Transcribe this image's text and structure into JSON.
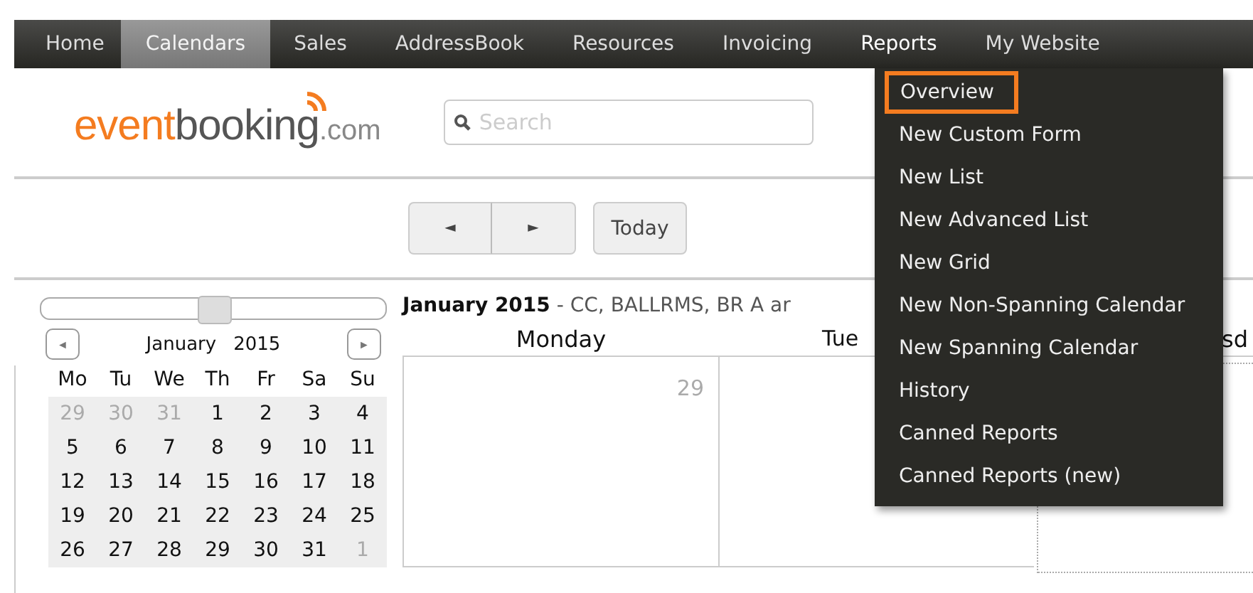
{
  "nav": [
    {
      "label": "Home",
      "selected": false,
      "expanded": false
    },
    {
      "label": "Calendars",
      "selected": true,
      "expanded": false
    },
    {
      "label": "Sales",
      "selected": false,
      "expanded": false
    },
    {
      "label": "AddressBook",
      "selected": false,
      "expanded": false
    },
    {
      "label": "Resources",
      "selected": false,
      "expanded": false
    },
    {
      "label": "Invoicing",
      "selected": false,
      "expanded": false
    },
    {
      "label": "Reports",
      "selected": false,
      "expanded": true
    },
    {
      "label": "My Website",
      "selected": false,
      "expanded": false
    }
  ],
  "logo": {
    "part_1": "event",
    "part_2": "booking",
    "part_3": ".com"
  },
  "search": {
    "placeholder": "Search"
  },
  "toolbar": {
    "prev": "◄",
    "next": "►",
    "today": "Today"
  },
  "sidebar": {
    "slider": {
      "level": 0.5
    },
    "month": "January",
    "year": "2015",
    "prev": "◄",
    "next": "►",
    "weekdays": [
      "Mo",
      "Tu",
      "We",
      "Th",
      "Fr",
      "Sa",
      "Su"
    ],
    "weeks": [
      [
        {
          "day": "29",
          "muted": true
        },
        {
          "day": "30",
          "muted": true
        },
        {
          "day": "31",
          "muted": true
        },
        {
          "day": "1",
          "muted": false
        },
        {
          "day": "2",
          "muted": false
        },
        {
          "day": "3",
          "muted": false
        },
        {
          "day": "4",
          "muted": false
        }
      ],
      [
        {
          "day": "5",
          "muted": false
        },
        {
          "day": "6",
          "muted": false
        },
        {
          "day": "7",
          "muted": false
        },
        {
          "day": "8",
          "muted": false
        },
        {
          "day": "9",
          "muted": false
        },
        {
          "day": "10",
          "muted": false
        },
        {
          "day": "11",
          "muted": false
        }
      ],
      [
        {
          "day": "12",
          "muted": false
        },
        {
          "day": "13",
          "muted": false
        },
        {
          "day": "14",
          "muted": false
        },
        {
          "day": "15",
          "muted": false
        },
        {
          "day": "16",
          "muted": false
        },
        {
          "day": "17",
          "muted": false
        },
        {
          "day": "18",
          "muted": false
        }
      ],
      [
        {
          "day": "19",
          "muted": false
        },
        {
          "day": "20",
          "muted": false
        },
        {
          "day": "21",
          "muted": false
        },
        {
          "day": "22",
          "muted": false
        },
        {
          "day": "23",
          "muted": false
        },
        {
          "day": "24",
          "muted": false
        },
        {
          "day": "25",
          "muted": false
        }
      ],
      [
        {
          "day": "26",
          "muted": false
        },
        {
          "day": "27",
          "muted": false
        },
        {
          "day": "28",
          "muted": false
        },
        {
          "day": "29",
          "muted": false
        },
        {
          "day": "30",
          "muted": false
        },
        {
          "day": "31",
          "muted": false
        },
        {
          "day": "1",
          "muted": true
        }
      ]
    ]
  },
  "calendar": {
    "title": "January 2015",
    "subtitle": "- CC, BALLRMS, BR A ar",
    "columns": [
      "Monday",
      "Tue",
      "sd"
    ],
    "first_cell_day": "29"
  },
  "menu": {
    "items": [
      {
        "label": "Overview",
        "selected": true
      },
      {
        "label": "New Custom Form",
        "selected": false
      },
      {
        "label": "New List",
        "selected": false
      },
      {
        "label": "New Advanced List",
        "selected": false
      },
      {
        "label": "New Grid",
        "selected": false
      },
      {
        "label": "New Non-Spanning Calendar",
        "selected": false
      },
      {
        "label": "New Spanning Calendar",
        "selected": false
      },
      {
        "label": "History",
        "selected": false
      },
      {
        "label": "Canned Reports",
        "selected": false
      },
      {
        "label": "Canned Reports (new)",
        "selected": false
      }
    ]
  }
}
